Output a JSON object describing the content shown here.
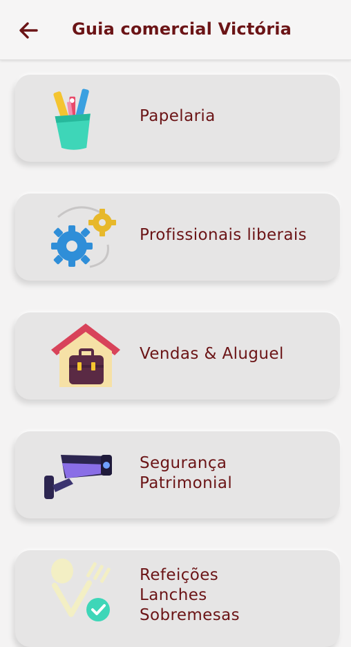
{
  "header": {
    "title": "Guia comercial Victória",
    "back_icon": "arrow-left-icon"
  },
  "categories": [
    {
      "lines": [
        "Papelaria"
      ],
      "icon": "pencil-cup-icon"
    },
    {
      "lines": [
        "Profissionais liberais"
      ],
      "icon": "gears-icon"
    },
    {
      "lines": [
        "Vendas & Aluguel"
      ],
      "icon": "house-briefcase-icon"
    },
    {
      "lines": [
        "Segurança",
        "Patrimonial"
      ],
      "icon": "security-camera-icon"
    },
    {
      "lines": [
        "Refeições",
        "Lanches",
        "Sobremesas"
      ],
      "icon": "spoon-fork-icon"
    }
  ],
  "colors": {
    "accent": "#6b1416",
    "card": "#e6e5e5",
    "background": "#f4f3f3"
  }
}
